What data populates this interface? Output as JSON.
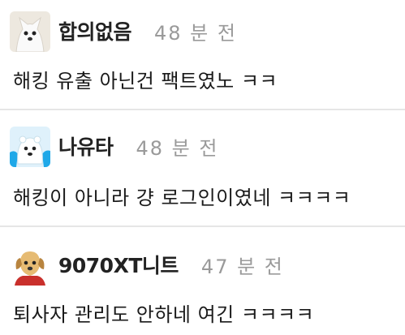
{
  "comments": [
    {
      "username": "합의없음",
      "time": "48 분 전",
      "text": "해킹 유출 아닌건 팩트였노 ㅋㅋ",
      "avatar_icon": "white-dog-avatar-icon"
    },
    {
      "username": "나유타",
      "time": "48 분 전",
      "text": "해킹이 아니라 걍 로그인이였네 ㅋㅋㅋㅋ",
      "avatar_icon": "polar-bear-avatar-icon"
    },
    {
      "username": "9070XT니트",
      "time": "47 분 전",
      "text": "퇴사자 관리도 안하네 여긴 ㅋㅋㅋㅋ",
      "avatar_icon": "puppy-avatar-icon"
    }
  ],
  "colors": {
    "username": "#222222",
    "time": "#9a9a9a",
    "divider": "#e6e6e6",
    "background": "#ffffff"
  }
}
